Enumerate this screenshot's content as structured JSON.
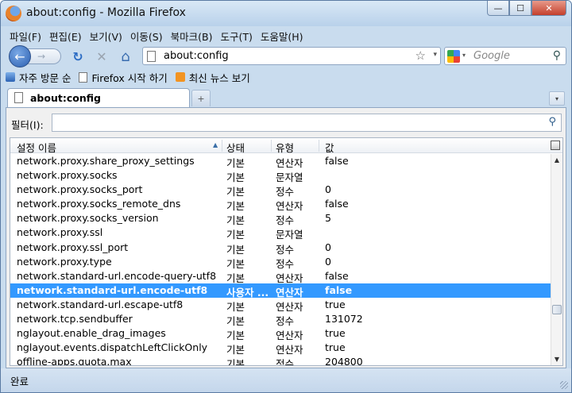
{
  "window": {
    "title": "about:config - Mozilla Firefox",
    "controls": {
      "minimize": "—",
      "maximize": "☐",
      "close": "✕"
    }
  },
  "menu": [
    "파일(F)",
    "편집(E)",
    "보기(V)",
    "이동(S)",
    "북마크(B)",
    "도구(T)",
    "도움말(H)"
  ],
  "nav": {
    "back": "←",
    "forward": "→",
    "reload": "↻",
    "stop": "✕",
    "home": "⌂",
    "url": "about:config",
    "star": "☆",
    "dropdown": "▾",
    "search_placeholder": "Google",
    "search_drop": "▾",
    "search_icon": "⚲"
  },
  "bookmarks": [
    "자주 방문 순",
    "Firefox 시작 하기",
    "최신 뉴스 보기"
  ],
  "tabs": {
    "active": "about:config",
    "new_tab": "+",
    "list": "▾"
  },
  "filter": {
    "label": "필터(I):",
    "value": "",
    "icon": "⚲"
  },
  "columns": {
    "name": "설정 이름",
    "status": "상태",
    "type": "유형",
    "value": "값",
    "sort": "▲"
  },
  "rows": [
    {
      "name": "network.proxy.share_proxy_settings",
      "status": "기본",
      "type": "연산자",
      "value": "false"
    },
    {
      "name": "network.proxy.socks",
      "status": "기본",
      "type": "문자열",
      "value": ""
    },
    {
      "name": "network.proxy.socks_port",
      "status": "기본",
      "type": "정수",
      "value": "0"
    },
    {
      "name": "network.proxy.socks_remote_dns",
      "status": "기본",
      "type": "연산자",
      "value": "false"
    },
    {
      "name": "network.proxy.socks_version",
      "status": "기본",
      "type": "정수",
      "value": "5"
    },
    {
      "name": "network.proxy.ssl",
      "status": "기본",
      "type": "문자열",
      "value": ""
    },
    {
      "name": "network.proxy.ssl_port",
      "status": "기본",
      "type": "정수",
      "value": "0"
    },
    {
      "name": "network.proxy.type",
      "status": "기본",
      "type": "정수",
      "value": "0"
    },
    {
      "name": "network.standard-url.encode-query-utf8",
      "status": "기본",
      "type": "연산자",
      "value": "false"
    },
    {
      "name": "network.standard-url.encode-utf8",
      "status": "사용자 ...",
      "type": "연산자",
      "value": "false",
      "selected": true
    },
    {
      "name": "network.standard-url.escape-utf8",
      "status": "기본",
      "type": "연산자",
      "value": "true"
    },
    {
      "name": "network.tcp.sendbuffer",
      "status": "기본",
      "type": "정수",
      "value": "131072"
    },
    {
      "name": "nglayout.enable_drag_images",
      "status": "기본",
      "type": "연산자",
      "value": "true"
    },
    {
      "name": "nglayout.events.dispatchLeftClickOnly",
      "status": "기본",
      "type": "연산자",
      "value": "true"
    },
    {
      "name": "offline-apps.quota.max",
      "status": "기본",
      "type": "정수",
      "value": "204800"
    }
  ],
  "scrollbar": {
    "up": "▲",
    "down": "▼"
  },
  "status": "완료"
}
